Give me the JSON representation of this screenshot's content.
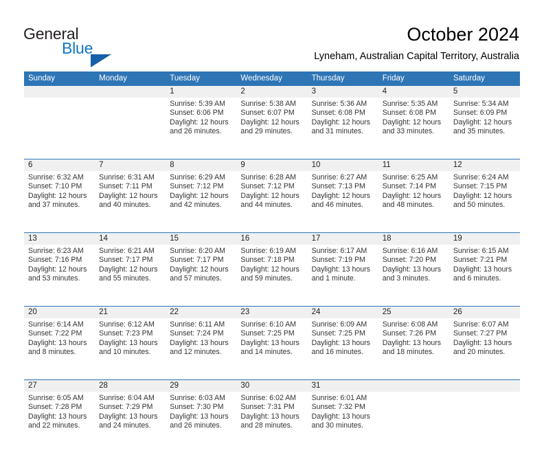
{
  "brand": {
    "name_part1": "General",
    "name_part2": "Blue",
    "accent_color": "#1175c6",
    "triangle_color": "#1560a8"
  },
  "header": {
    "title": "October 2024",
    "subtitle": "Lyneham, Australian Capital Territory, Australia"
  },
  "calendar": {
    "header_bg": "#2e75b6",
    "daynum_bg": "#f0f0f0",
    "weekdays": [
      "Sunday",
      "Monday",
      "Tuesday",
      "Wednesday",
      "Thursday",
      "Friday",
      "Saturday"
    ],
    "weeks": [
      {
        "days": [
          {
            "date": "",
            "lines": []
          },
          {
            "date": "",
            "lines": []
          },
          {
            "date": "1",
            "lines": [
              "Sunrise: 5:39 AM",
              "Sunset: 6:06 PM",
              "Daylight: 12 hours",
              "and 26 minutes."
            ]
          },
          {
            "date": "2",
            "lines": [
              "Sunrise: 5:38 AM",
              "Sunset: 6:07 PM",
              "Daylight: 12 hours",
              "and 29 minutes."
            ]
          },
          {
            "date": "3",
            "lines": [
              "Sunrise: 5:36 AM",
              "Sunset: 6:08 PM",
              "Daylight: 12 hours",
              "and 31 minutes."
            ]
          },
          {
            "date": "4",
            "lines": [
              "Sunrise: 5:35 AM",
              "Sunset: 6:08 PM",
              "Daylight: 12 hours",
              "and 33 minutes."
            ]
          },
          {
            "date": "5",
            "lines": [
              "Sunrise: 5:34 AM",
              "Sunset: 6:09 PM",
              "Daylight: 12 hours",
              "and 35 minutes."
            ]
          }
        ]
      },
      {
        "days": [
          {
            "date": "6",
            "lines": [
              "Sunrise: 6:32 AM",
              "Sunset: 7:10 PM",
              "Daylight: 12 hours",
              "and 37 minutes."
            ]
          },
          {
            "date": "7",
            "lines": [
              "Sunrise: 6:31 AM",
              "Sunset: 7:11 PM",
              "Daylight: 12 hours",
              "and 40 minutes."
            ]
          },
          {
            "date": "8",
            "lines": [
              "Sunrise: 6:29 AM",
              "Sunset: 7:12 PM",
              "Daylight: 12 hours",
              "and 42 minutes."
            ]
          },
          {
            "date": "9",
            "lines": [
              "Sunrise: 6:28 AM",
              "Sunset: 7:12 PM",
              "Daylight: 12 hours",
              "and 44 minutes."
            ]
          },
          {
            "date": "10",
            "lines": [
              "Sunrise: 6:27 AM",
              "Sunset: 7:13 PM",
              "Daylight: 12 hours",
              "and 46 minutes."
            ]
          },
          {
            "date": "11",
            "lines": [
              "Sunrise: 6:25 AM",
              "Sunset: 7:14 PM",
              "Daylight: 12 hours",
              "and 48 minutes."
            ]
          },
          {
            "date": "12",
            "lines": [
              "Sunrise: 6:24 AM",
              "Sunset: 7:15 PM",
              "Daylight: 12 hours",
              "and 50 minutes."
            ]
          }
        ]
      },
      {
        "days": [
          {
            "date": "13",
            "lines": [
              "Sunrise: 6:23 AM",
              "Sunset: 7:16 PM",
              "Daylight: 12 hours",
              "and 53 minutes."
            ]
          },
          {
            "date": "14",
            "lines": [
              "Sunrise: 6:21 AM",
              "Sunset: 7:17 PM",
              "Daylight: 12 hours",
              "and 55 minutes."
            ]
          },
          {
            "date": "15",
            "lines": [
              "Sunrise: 6:20 AM",
              "Sunset: 7:17 PM",
              "Daylight: 12 hours",
              "and 57 minutes."
            ]
          },
          {
            "date": "16",
            "lines": [
              "Sunrise: 6:19 AM",
              "Sunset: 7:18 PM",
              "Daylight: 12 hours",
              "and 59 minutes."
            ]
          },
          {
            "date": "17",
            "lines": [
              "Sunrise: 6:17 AM",
              "Sunset: 7:19 PM",
              "Daylight: 13 hours",
              "and 1 minute."
            ]
          },
          {
            "date": "18",
            "lines": [
              "Sunrise: 6:16 AM",
              "Sunset: 7:20 PM",
              "Daylight: 13 hours",
              "and 3 minutes."
            ]
          },
          {
            "date": "19",
            "lines": [
              "Sunrise: 6:15 AM",
              "Sunset: 7:21 PM",
              "Daylight: 13 hours",
              "and 6 minutes."
            ]
          }
        ]
      },
      {
        "days": [
          {
            "date": "20",
            "lines": [
              "Sunrise: 6:14 AM",
              "Sunset: 7:22 PM",
              "Daylight: 13 hours",
              "and 8 minutes."
            ]
          },
          {
            "date": "21",
            "lines": [
              "Sunrise: 6:12 AM",
              "Sunset: 7:23 PM",
              "Daylight: 13 hours",
              "and 10 minutes."
            ]
          },
          {
            "date": "22",
            "lines": [
              "Sunrise: 6:11 AM",
              "Sunset: 7:24 PM",
              "Daylight: 13 hours",
              "and 12 minutes."
            ]
          },
          {
            "date": "23",
            "lines": [
              "Sunrise: 6:10 AM",
              "Sunset: 7:25 PM",
              "Daylight: 13 hours",
              "and 14 minutes."
            ]
          },
          {
            "date": "24",
            "lines": [
              "Sunrise: 6:09 AM",
              "Sunset: 7:25 PM",
              "Daylight: 13 hours",
              "and 16 minutes."
            ]
          },
          {
            "date": "25",
            "lines": [
              "Sunrise: 6:08 AM",
              "Sunset: 7:26 PM",
              "Daylight: 13 hours",
              "and 18 minutes."
            ]
          },
          {
            "date": "26",
            "lines": [
              "Sunrise: 6:07 AM",
              "Sunset: 7:27 PM",
              "Daylight: 13 hours",
              "and 20 minutes."
            ]
          }
        ]
      },
      {
        "days": [
          {
            "date": "27",
            "lines": [
              "Sunrise: 6:05 AM",
              "Sunset: 7:28 PM",
              "Daylight: 13 hours",
              "and 22 minutes."
            ]
          },
          {
            "date": "28",
            "lines": [
              "Sunrise: 6:04 AM",
              "Sunset: 7:29 PM",
              "Daylight: 13 hours",
              "and 24 minutes."
            ]
          },
          {
            "date": "29",
            "lines": [
              "Sunrise: 6:03 AM",
              "Sunset: 7:30 PM",
              "Daylight: 13 hours",
              "and 26 minutes."
            ]
          },
          {
            "date": "30",
            "lines": [
              "Sunrise: 6:02 AM",
              "Sunset: 7:31 PM",
              "Daylight: 13 hours",
              "and 28 minutes."
            ]
          },
          {
            "date": "31",
            "lines": [
              "Sunrise: 6:01 AM",
              "Sunset: 7:32 PM",
              "Daylight: 13 hours",
              "and 30 minutes."
            ]
          },
          {
            "date": "",
            "lines": []
          },
          {
            "date": "",
            "lines": []
          }
        ]
      }
    ]
  }
}
